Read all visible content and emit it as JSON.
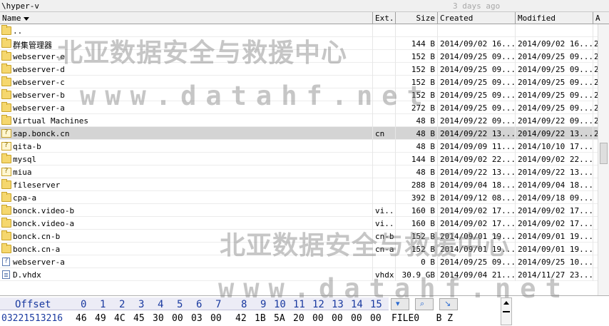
{
  "path_bar": {
    "path": "\\hyper-v",
    "last_modified": "3 days ago"
  },
  "columns": {
    "name": "Name",
    "ext": "Ext.",
    "size": "Size",
    "created": "Created",
    "modified": "Modified",
    "attr": "A"
  },
  "rows": [
    {
      "icon": "folder-up-icon",
      "name": "..",
      "ext": "",
      "size": "",
      "created": "",
      "modified": "",
      "attr": ""
    },
    {
      "icon": "folder-icon",
      "name": "群集管理器",
      "ext": "",
      "size": "144 B",
      "created": "2014/09/02  16...",
      "modified": "2014/09/02  16...",
      "attr": "2"
    },
    {
      "icon": "folder-icon",
      "name": "webserver-e",
      "ext": "",
      "size": "152 B",
      "created": "2014/09/25  09...",
      "modified": "2014/09/25  09...",
      "attr": "2"
    },
    {
      "icon": "folder-icon",
      "name": "webserver-d",
      "ext": "",
      "size": "152 B",
      "created": "2014/09/25  09...",
      "modified": "2014/09/25  09...",
      "attr": "2"
    },
    {
      "icon": "folder-icon",
      "name": "webserver-c",
      "ext": "",
      "size": "152 B",
      "created": "2014/09/25  09...",
      "modified": "2014/09/25  09...",
      "attr": "2"
    },
    {
      "icon": "folder-icon",
      "name": "webserver-b",
      "ext": "",
      "size": "152 B",
      "created": "2014/09/25  09...",
      "modified": "2014/09/25  09...",
      "attr": "2"
    },
    {
      "icon": "folder-icon",
      "name": "webserver-a",
      "ext": "",
      "size": "272 B",
      "created": "2014/09/25  09...",
      "modified": "2014/09/25  09...",
      "attr": "2"
    },
    {
      "icon": "folder-icon",
      "name": "Virtual Machines",
      "ext": "",
      "size": "48 B",
      "created": "2014/09/22  09...",
      "modified": "2014/09/22  09...",
      "attr": "2"
    },
    {
      "icon": "unknown-folder-icon",
      "name": "sap.bonck.cn",
      "ext": "cn",
      "size": "48 B",
      "created": "2014/09/22  13...",
      "modified": "2014/09/22  13...",
      "attr": "2",
      "selected": true
    },
    {
      "icon": "unknown-folder-icon",
      "name": "qita-b",
      "ext": "",
      "size": "48 B",
      "created": "2014/09/09  11...",
      "modified": "2014/10/10  17...",
      "attr": ""
    },
    {
      "icon": "folder-icon",
      "name": "mysql",
      "ext": "",
      "size": "144 B",
      "created": "2014/09/02  22...",
      "modified": "2014/09/02  22...",
      "attr": ""
    },
    {
      "icon": "unknown-folder-icon",
      "name": "miua",
      "ext": "",
      "size": "48 B",
      "created": "2014/09/22  13...",
      "modified": "2014/09/22  13...",
      "attr": ""
    },
    {
      "icon": "folder-icon",
      "name": "fileserver",
      "ext": "",
      "size": "288 B",
      "created": "2014/09/04  18...",
      "modified": "2014/09/04  18...",
      "attr": ""
    },
    {
      "icon": "folder-icon",
      "name": "cpa-a",
      "ext": "",
      "size": "392 B",
      "created": "2014/09/12  08...",
      "modified": "2014/09/18  09...",
      "attr": ""
    },
    {
      "icon": "folder-icon",
      "name": "bonck.video-b",
      "ext": "vi...",
      "size": "160 B",
      "created": "2014/09/02  17...",
      "modified": "2014/09/02  17...",
      "attr": ""
    },
    {
      "icon": "folder-icon",
      "name": "bonck.video-a",
      "ext": "vi...",
      "size": "160 B",
      "created": "2014/09/02  17...",
      "modified": "2014/09/02  17...",
      "attr": ""
    },
    {
      "icon": "folder-icon",
      "name": "bonck.cn-b",
      "ext": "cn-b",
      "size": "152 B",
      "created": "2014/09/01  19...",
      "modified": "2014/09/01  19...",
      "attr": ""
    },
    {
      "icon": "folder-icon",
      "name": "bonck.cn-a",
      "ext": "cn-a",
      "size": "152 B",
      "created": "2014/09/01  19...",
      "modified": "2014/09/01  19...",
      "attr": ""
    },
    {
      "icon": "unknown-file-icon",
      "name": "webserver-a",
      "ext": "",
      "size": "0 B",
      "created": "2014/09/25  09...",
      "modified": "2014/09/25  10...",
      "attr": ""
    },
    {
      "icon": "file-icon",
      "name": "D.vhdx",
      "ext": "vhdx",
      "size": "30.9 GB",
      "created": "2014/09/04  21...",
      "modified": "2014/11/27  23...",
      "attr": ""
    }
  ],
  "hex": {
    "offset_label": "Offset",
    "columns": [
      "0",
      "1",
      "2",
      "3",
      "4",
      "5",
      "6",
      "7",
      "8",
      "9",
      "10",
      "11",
      "12",
      "13",
      "14",
      "15"
    ],
    "offset": "03221513216",
    "bytes": [
      "46",
      "49",
      "4C",
      "45",
      "30",
      "00",
      "03",
      "00",
      "42",
      "1B",
      "5A",
      "20",
      "00",
      "00",
      "00",
      "00"
    ],
    "ascii": "FILE0   B Z",
    "tools": [
      "chevron-down-icon",
      "search-icon",
      "arrow-right-icon"
    ]
  },
  "watermarks": [
    "北亚数据安全与救援中心",
    "www.datahf.net"
  ]
}
